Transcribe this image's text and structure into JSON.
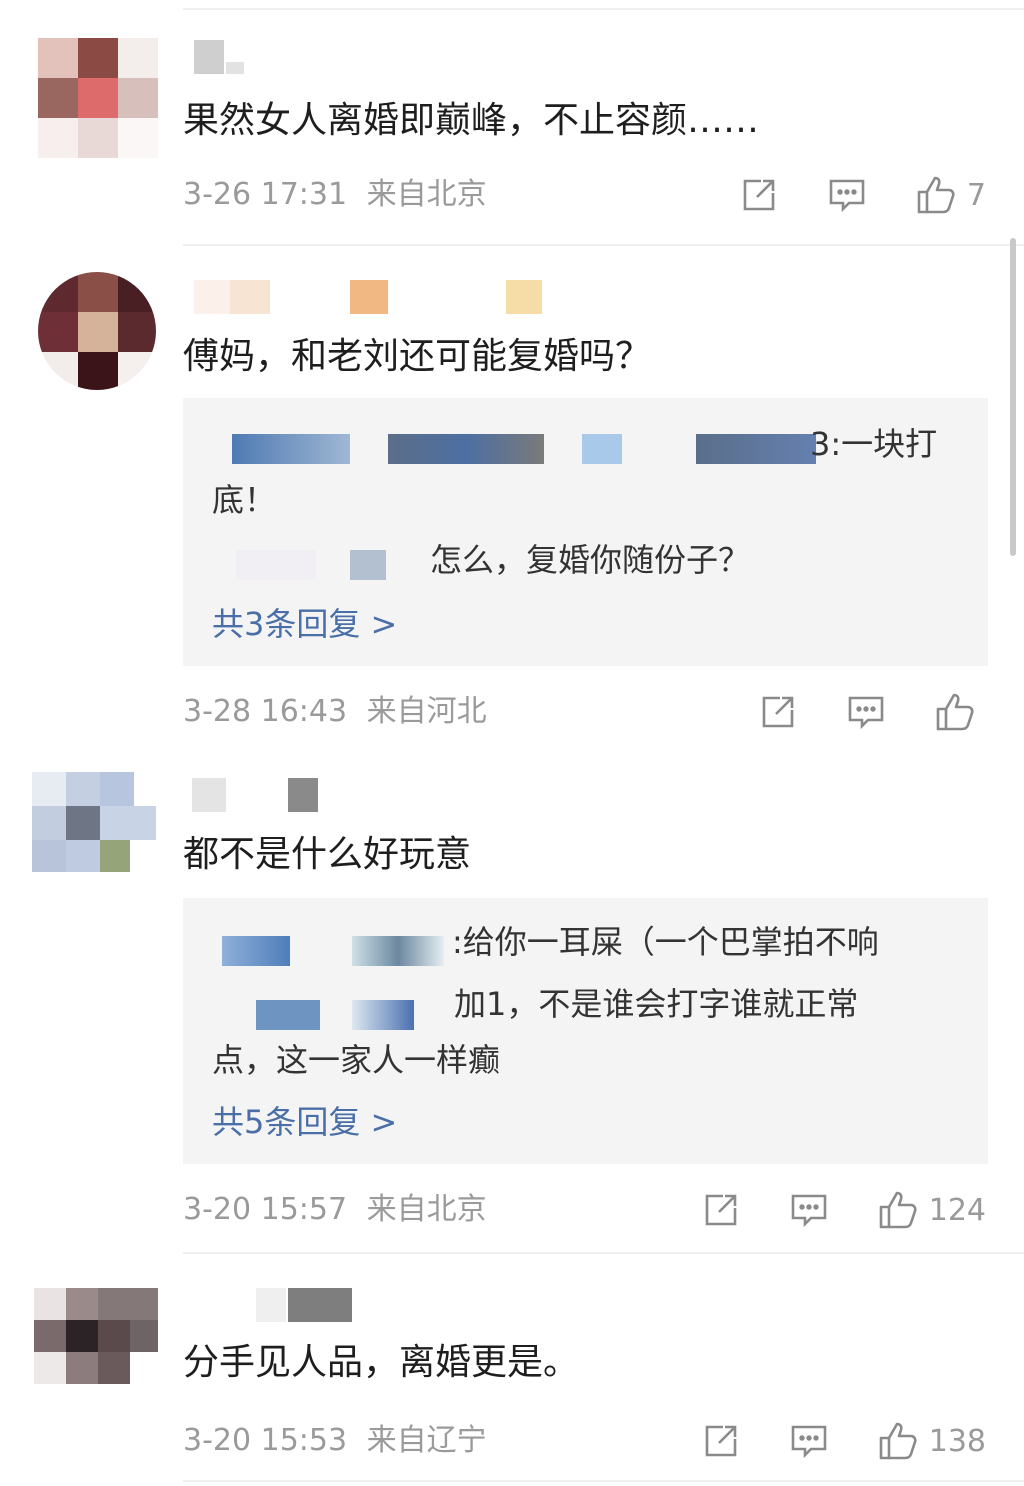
{
  "comments": [
    {
      "text": "果然女人离婚即巅峰，不止容颜……",
      "time": "3-26 17:31",
      "location": "来自北京",
      "likes": "7"
    },
    {
      "text": "傅妈，和老刘还可能复婚吗？",
      "replies": [
        {
          "text": "3:一块打"
        },
        {
          "text": "底！"
        },
        {
          "text": "怎么，复婚你随份子？"
        }
      ],
      "more_replies": "共3条回复 >",
      "time": "3-28 16:43",
      "location": "来自河北",
      "likes": ""
    },
    {
      "text": "都不是什么好玩意",
      "replies": [
        {
          "text": ":给你一耳屎（一个巴掌拍不响"
        },
        {
          "text": "加1，不是谁会打字谁就正常"
        },
        {
          "text": "点，这一家人一样癫"
        }
      ],
      "more_replies": "共5条回复 >",
      "time": "3-20 15:57",
      "location": "来自北京",
      "likes": "124"
    },
    {
      "text": "分手见人品，离婚更是。",
      "time": "3-20 15:53",
      "location": "来自辽宁",
      "likes": "138"
    }
  ],
  "icons": {
    "share": "share-icon",
    "comment": "comment-icon",
    "like": "thumbs-up-icon"
  },
  "colors": {
    "reply_link": "#4a6fa8",
    "meta_text": "#9a9a9a",
    "reply_bg": "#f4f4f4"
  }
}
